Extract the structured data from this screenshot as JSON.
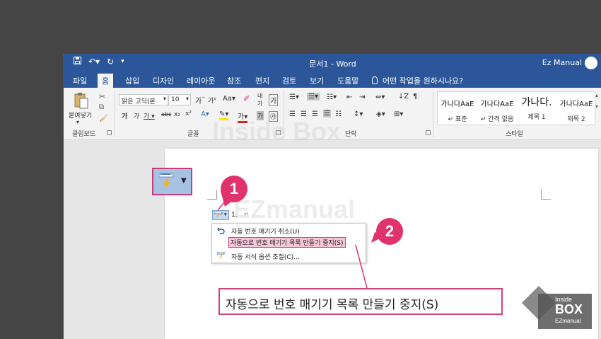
{
  "titlebar": {
    "doc_title": "문서1  -  Word",
    "user_name": "Ez Manual",
    "qat": {
      "save_icon": "save-icon",
      "undo_icon": "undo-icon",
      "redo_icon": "redo-icon",
      "customize_icon": "customize-qat-icon"
    },
    "colors": {
      "accent": "#2b579a"
    }
  },
  "tabs": {
    "items": [
      "파일",
      "홈",
      "삽입",
      "디자인",
      "레이아웃",
      "참조",
      "편지",
      "검토",
      "보기",
      "도움말"
    ],
    "tell_me": "어떤 작업을 원하시나요?"
  },
  "ribbon": {
    "clipboard": {
      "label": "클립보드",
      "paste_label": "붙여넣기"
    },
    "font": {
      "label": "글꼴",
      "font_name": "맑은 고딕(본",
      "font_size": "10"
    },
    "paragraph": {
      "label": "단락"
    },
    "styles": {
      "label": "스타일",
      "items": [
        {
          "preview": "가나다AaE",
          "name": "↵ 표준"
        },
        {
          "preview": "가나다AaE",
          "name": "↵ 간격 없음"
        },
        {
          "preview": "가나다.",
          "name": "제목 1"
        },
        {
          "preview": "가나다AaE",
          "name": "제목 2"
        }
      ]
    }
  },
  "document": {
    "list_number": "1.",
    "paragraph_mark": "↵"
  },
  "autocorrect_menu": {
    "items": [
      {
        "label": "자동 번호 매기기 취소(U)",
        "icon": "undo-arrow-icon"
      },
      {
        "label": "자동으로 번호 매기기 목록 만들기 중지(S)",
        "icon": ""
      },
      {
        "label": "자동 서식 옵션 조절(C)...",
        "icon": "autoformat-icon"
      }
    ]
  },
  "callouts": {
    "one": "1",
    "two": "2"
  },
  "zoom_label": "자동으로 번호 매기기 목록 만들기 중지(S)",
  "watermark": {
    "brand": "Inside Box",
    "sub": "EZmanual",
    "logo_top": "Inside",
    "logo_mid": "BOX",
    "logo_bottom": "EZmanual"
  },
  "colors": {
    "highlight": "#e0336e",
    "menu_highlight": "#f7c6d9"
  }
}
